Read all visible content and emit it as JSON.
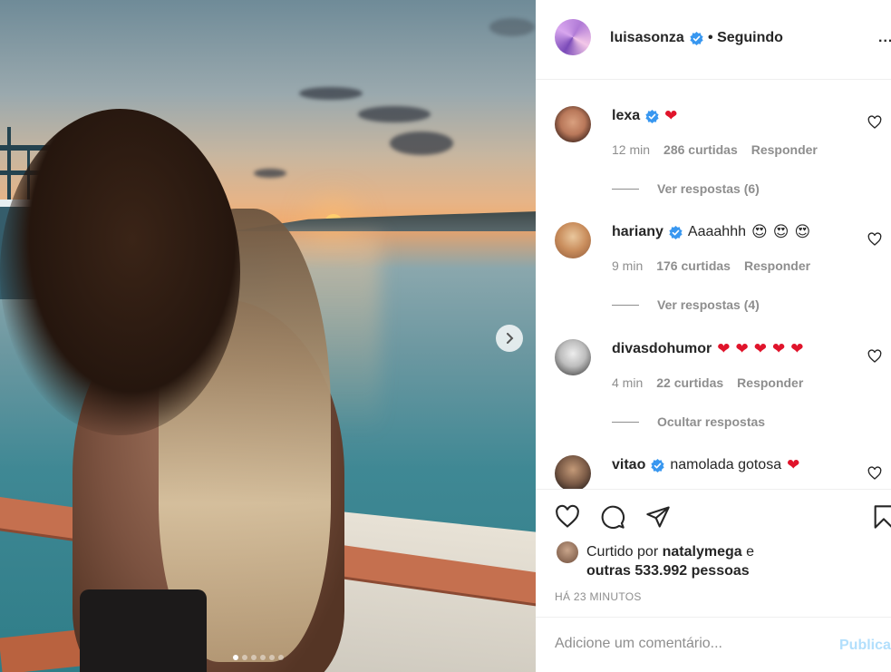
{
  "post": {
    "photo_alt": "",
    "carousel": {
      "count": 6,
      "active": 0
    }
  },
  "header": {
    "username": "luisasonza",
    "separator": "•",
    "follow_status": "Seguindo",
    "more": "..."
  },
  "comments": [
    {
      "user": "lexa",
      "verified": true,
      "text": "",
      "emojis": [
        "❤"
      ],
      "time": "12 min",
      "likes": "286 curtidas",
      "reply": "Responder",
      "replies_toggle": "Ver respostas (6)",
      "avatar_colors": [
        "#d9a07f",
        "#4a2c22"
      ]
    },
    {
      "user": "hariany",
      "verified": true,
      "text": "Aaaahhh",
      "emojis": [
        "😍",
        "😍",
        "😍"
      ],
      "time": "9 min",
      "likes": "176 curtidas",
      "reply": "Responder",
      "replies_toggle": "Ver respostas (4)",
      "avatar_colors": [
        "#e9c79d",
        "#a06a45"
      ]
    },
    {
      "user": "divasdohumor",
      "verified": false,
      "text": "",
      "emojis": [
        "❤",
        "❤",
        "❤",
        "❤",
        "❤"
      ],
      "time": "4 min",
      "likes": "22 curtidas",
      "reply": "Responder",
      "replies_toggle": "Ocultar respostas",
      "avatar_colors": [
        "#ededed",
        "#555555"
      ]
    },
    {
      "user": "vitao",
      "verified": true,
      "text": "namolada gotosa",
      "emojis": [
        "❤"
      ],
      "avatar_colors": [
        "#c49a78",
        "#2e2420"
      ]
    }
  ],
  "likes": {
    "prefix": "Curtido por",
    "user": "natalymega",
    "conj": "e",
    "others": "outras 533.992 pessoas"
  },
  "timestamp": "HÁ 23 MINUTOS",
  "add_comment": {
    "placeholder": "Adicione um comentário...",
    "publish": "Publicar"
  },
  "icons": {
    "like": "heart-icon",
    "comment": "comment-icon",
    "share": "share-icon",
    "save": "bookmark-icon",
    "next": "chevron-right-icon",
    "verified": "verified-badge-icon"
  },
  "colors": {
    "verified": "#3897f0",
    "heart_emoji": "#e0142b",
    "muted": "#8e8e8e",
    "publish_disabled": "#b2dffc"
  }
}
